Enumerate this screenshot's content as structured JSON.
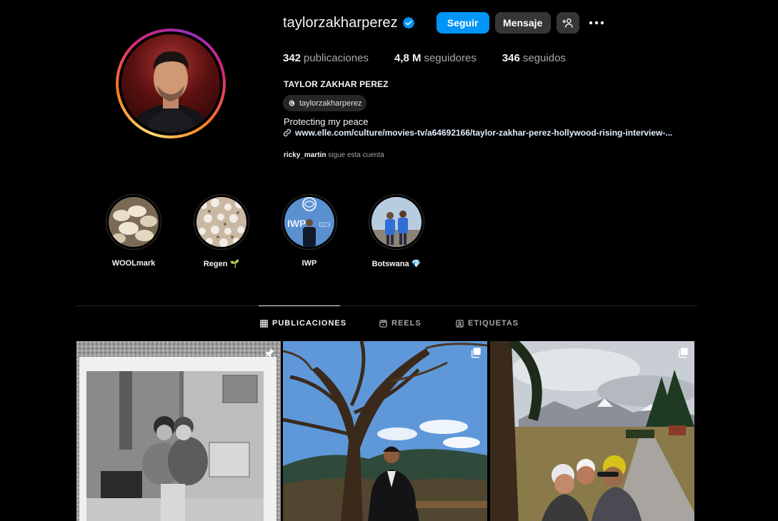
{
  "profile": {
    "username": "taylorzakharperez",
    "full_name": "TAYLOR ZAKHAR PEREZ",
    "threads_handle": "taylorzakharperez",
    "bio": "Protecting my peace",
    "link": "www.elle.com/culture/movies-tv/a64692166/taylor-zakhar-perez-hollywood-rising-interview-...",
    "followed_by_user": "ricky_martin",
    "followed_by_text": "sigue esta cuenta"
  },
  "buttons": {
    "follow": "Seguir",
    "message": "Mensaje"
  },
  "stats": [
    {
      "value": "342",
      "label": "publicaciones"
    },
    {
      "value": "4,8 M",
      "label": "seguidores"
    },
    {
      "value": "346",
      "label": "seguidos"
    }
  ],
  "highlights": [
    {
      "label": "WOOLmark"
    },
    {
      "label": "Regen 🌱"
    },
    {
      "label": "IWP"
    },
    {
      "label": "Botswana 💎"
    }
  ],
  "tabs": [
    {
      "label": "PUBLICACIONES",
      "icon": "grid-icon",
      "active": true
    },
    {
      "label": "REELS",
      "icon": "reels-icon",
      "active": false
    },
    {
      "label": "ETIQUETAS",
      "icon": "tagged-icon",
      "active": false
    }
  ],
  "posts": [
    {
      "icon": "pin-icon"
    },
    {
      "icon": "carousel-icon"
    },
    {
      "icon": "carousel-icon"
    }
  ],
  "colors": {
    "accent": "#0095f6",
    "background": "#000000",
    "button_secondary": "#363636"
  }
}
